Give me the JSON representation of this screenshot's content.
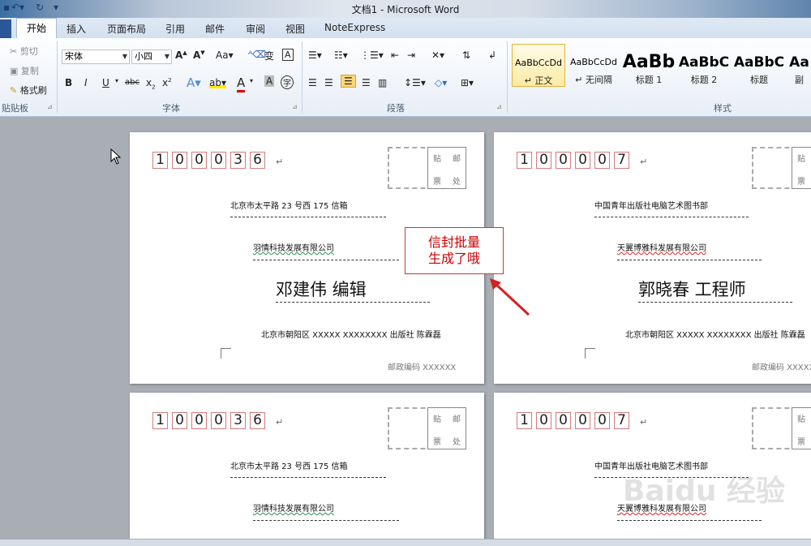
{
  "window": {
    "title": "文档1 - Microsoft Word"
  },
  "ribbon": {
    "tabs": [
      "开始",
      "插入",
      "页面布局",
      "引用",
      "邮件",
      "审阅",
      "视图",
      "NoteExpress"
    ],
    "active_tab": "开始",
    "clipboard": {
      "cut": "剪切",
      "copy": "复制",
      "format_painter": "格式刷",
      "label": "贴贴板"
    },
    "font": {
      "family": "宋体",
      "size": "小四",
      "label": "字体"
    },
    "paragraph": {
      "label": "段落"
    },
    "styles": {
      "label": "样式",
      "items": [
        {
          "preview": "AaBbCcDd",
          "name": "↵ 正文"
        },
        {
          "preview": "AaBbCcDd",
          "name": "↵ 无间隔"
        },
        {
          "preview": "AaBb",
          "name": "标题 1"
        },
        {
          "preview": "AaBbC",
          "name": "标题 2"
        },
        {
          "preview": "AaBbC",
          "name": "标题"
        },
        {
          "preview": "Aa",
          "name": "副"
        }
      ]
    }
  },
  "envelopes": [
    {
      "zip": [
        "1",
        "0",
        "0",
        "0",
        "3",
        "6"
      ],
      "address": "北京市太平路 23 号西 175 信箱",
      "company": "羽情科技发展有限公司",
      "recipient": "邓建伟  编辑",
      "sender": "北京市朝阳区 XXXXX XXXXXXXX 出版社 陈霖磊",
      "postcode": "邮政编码 XXXXXX"
    },
    {
      "zip": [
        "1",
        "0",
        "0",
        "0",
        "0",
        "7"
      ],
      "address": "中国青年出版社电脑艺术图书部",
      "company": "天翼博雅科发展有限公司",
      "recipient": "郭晓春  工程师",
      "sender": "北京市朝阳区 XXXXX XXXXXXXX 出版社 陈霖磊",
      "postcode": "邮政编码 XXXXXX"
    },
    {
      "zip": [
        "1",
        "0",
        "0",
        "0",
        "3",
        "6"
      ],
      "address": "北京市太平路 23 号西 175 信箱",
      "company": "羽情科技发展有限公司"
    },
    {
      "zip": [
        "1",
        "0",
        "0",
        "0",
        "0",
        "7"
      ],
      "address": "中国青年出版社电脑艺术图书部",
      "company": "天翼博雅科发展有限公司"
    }
  ],
  "stamp": {
    "line1a": "贴",
    "line1b": "邮",
    "line2a": "票",
    "line2b": "处"
  },
  "callout": {
    "line1": "信封批量",
    "line2": "生成了哦"
  },
  "watermark": "Baidu 经验"
}
